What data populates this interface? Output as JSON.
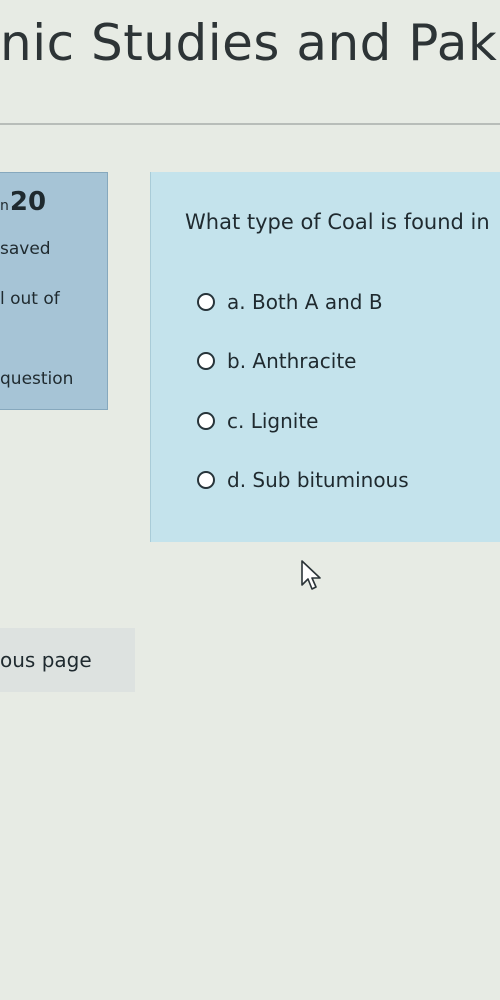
{
  "page": {
    "title": "nic Studies and Pak"
  },
  "info": {
    "number_prefix": "n",
    "number": "20",
    "status": "saved",
    "marks": "l out of",
    "flag": "question"
  },
  "question": {
    "text": "What type of Coal is found in",
    "options": [
      {
        "label": "a. Both A and B",
        "selected": false
      },
      {
        "label": "b. Anthracite",
        "selected": false
      },
      {
        "label": "c. Lignite",
        "selected": false
      },
      {
        "label": "d. Sub bituminous",
        "selected": false
      }
    ]
  },
  "navigation": {
    "previous_label": "ous page"
  },
  "icons": {
    "cursor": "mouse-pointer-icon",
    "radio": "radio-unchecked-icon"
  }
}
